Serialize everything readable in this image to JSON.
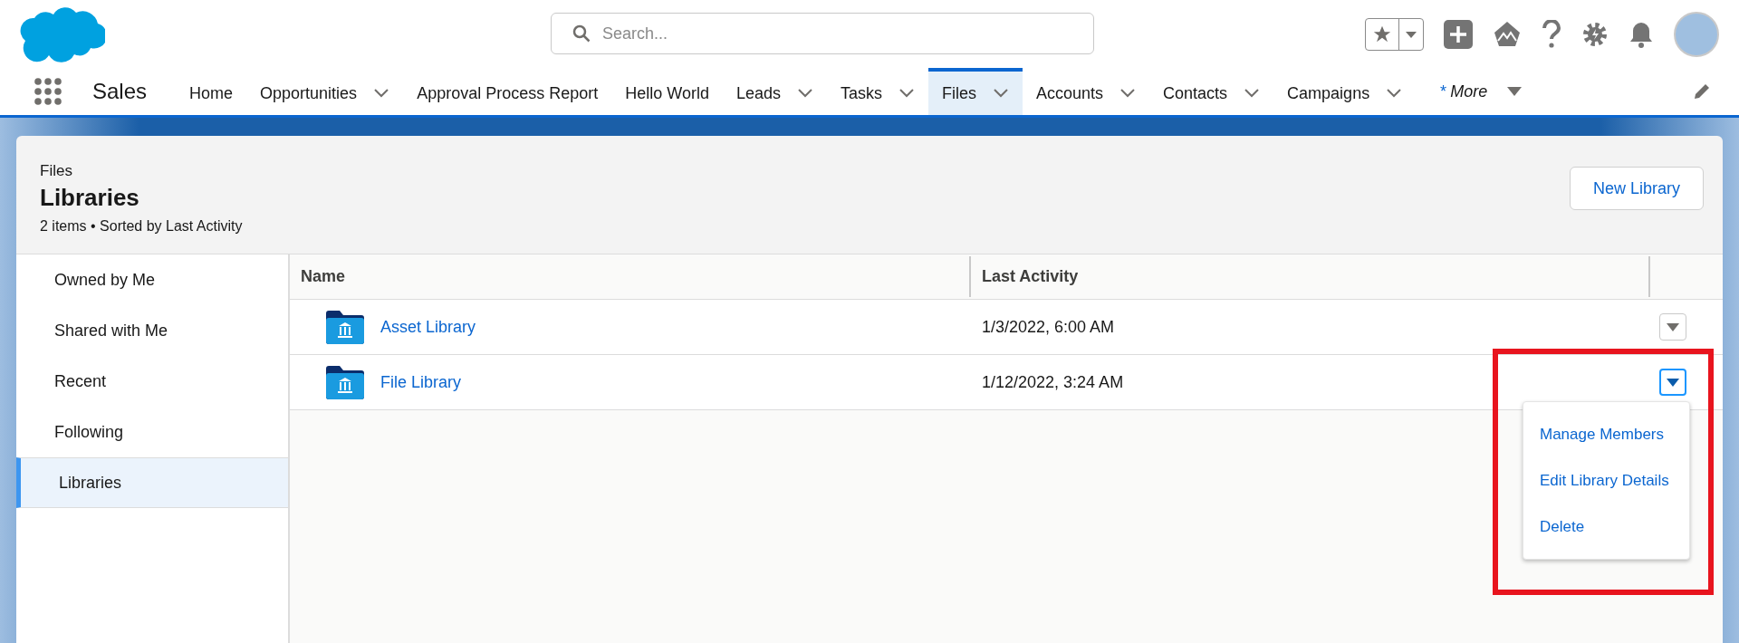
{
  "app": {
    "name": "Sales"
  },
  "search": {
    "placeholder": "Search..."
  },
  "nav": [
    {
      "label": "Home",
      "has_menu": false,
      "selected": false
    },
    {
      "label": "Opportunities",
      "has_menu": true,
      "selected": false
    },
    {
      "label": "Approval Process Report",
      "has_menu": false,
      "selected": false
    },
    {
      "label": "Hello World",
      "has_menu": false,
      "selected": false
    },
    {
      "label": "Leads",
      "has_menu": true,
      "selected": false
    },
    {
      "label": "Tasks",
      "has_menu": true,
      "selected": false
    },
    {
      "label": "Files",
      "has_menu": true,
      "selected": true
    },
    {
      "label": "Accounts",
      "has_menu": true,
      "selected": false
    },
    {
      "label": "Contacts",
      "has_menu": true,
      "selected": false
    },
    {
      "label": "Campaigns",
      "has_menu": true,
      "selected": false
    }
  ],
  "more": {
    "mark": "*",
    "label": "More"
  },
  "page": {
    "breadcrumb": "Files",
    "title": "Libraries",
    "subtitle": "2 items • Sorted by Last Activity",
    "button": "New Library"
  },
  "sidebar": {
    "items": [
      {
        "label": "Owned by Me",
        "selected": false
      },
      {
        "label": "Shared with Me",
        "selected": false
      },
      {
        "label": "Recent",
        "selected": false
      },
      {
        "label": "Following",
        "selected": false
      },
      {
        "label": "Libraries",
        "selected": true
      }
    ]
  },
  "table": {
    "columns": [
      "Name",
      "Last Activity"
    ],
    "rows": [
      {
        "name": "Asset Library",
        "last_activity": "1/3/2022, 6:00 AM",
        "menu_open": false
      },
      {
        "name": "File Library",
        "last_activity": "1/12/2022, 3:24 AM",
        "menu_open": true
      }
    ]
  },
  "row_menu": {
    "items": [
      "Manage Members",
      "Edit Library Details",
      "Delete"
    ]
  }
}
